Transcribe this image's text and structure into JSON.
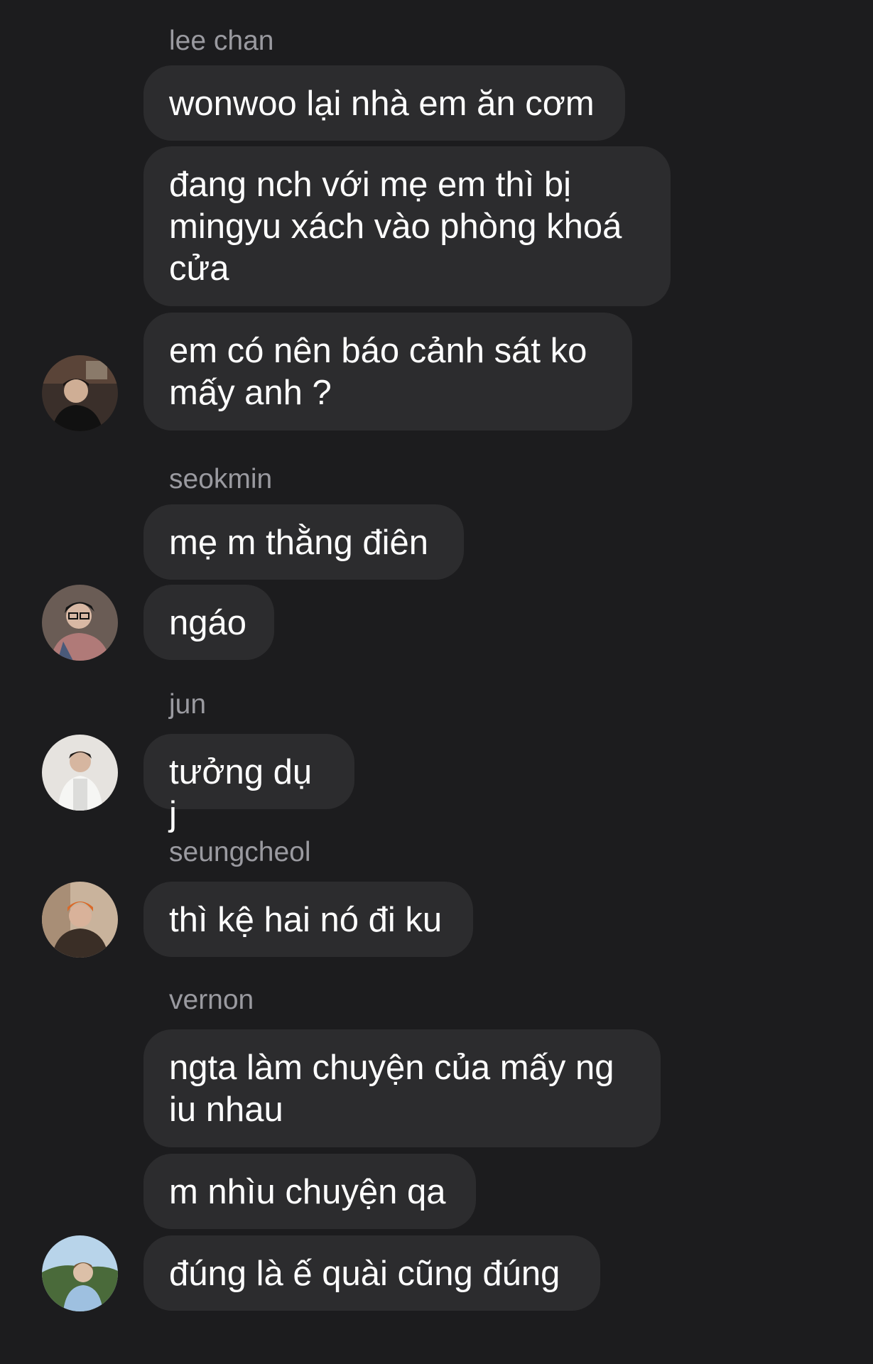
{
  "thread": {
    "groups": [
      {
        "sender": "lee chan",
        "messages": [
          "wonwoo lại nhà em ăn cơm",
          "đang nch với mẹ em thì bị\nmingyu xách vào phòng khoá\ncửa",
          "em có nên báo cảnh sát ko\nmấy anh ?"
        ]
      },
      {
        "sender": "seokmin",
        "messages": [
          "mẹ m thằng điên",
          "ngáo"
        ]
      },
      {
        "sender": "jun",
        "messages": [
          "tưởng dụ j"
        ]
      },
      {
        "sender": "seungcheol",
        "messages": [
          "thì kệ hai nó đi ku"
        ]
      },
      {
        "sender": "vernon",
        "messages": [
          "ngta làm chuyện của mấy ng\niu nhau",
          "m nhìu chuyện qa",
          "đúng là ế quài cũng đúng"
        ]
      }
    ]
  },
  "colors": {
    "background": "#1c1c1e",
    "bubble": "#2c2c2e",
    "sender_name": "#9a9aa0",
    "message_text": "#ffffff"
  }
}
